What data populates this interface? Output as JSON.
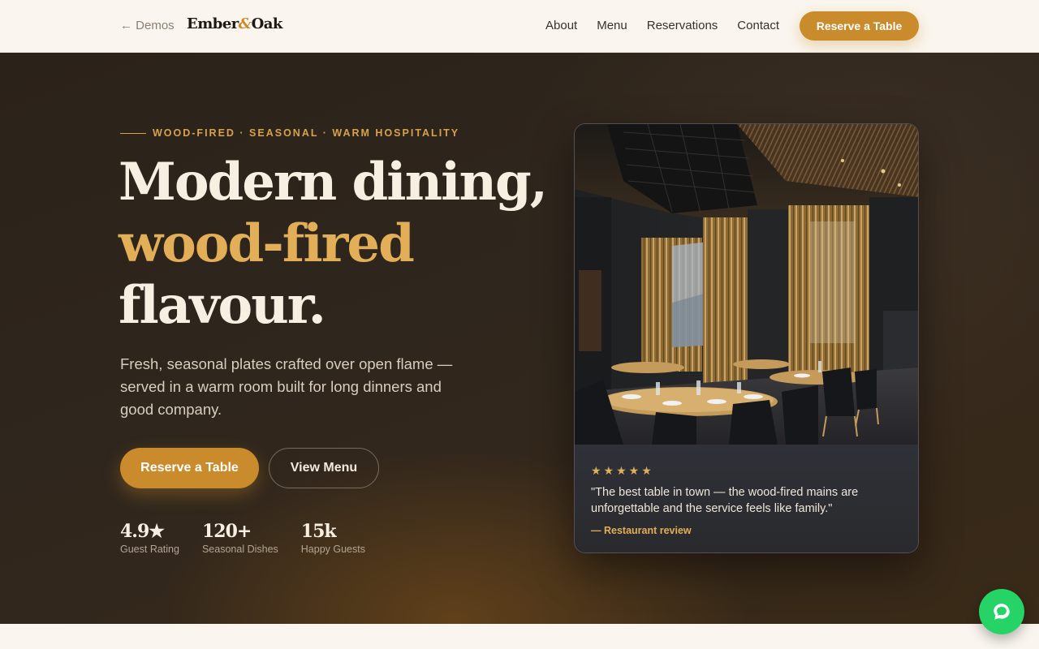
{
  "nav": {
    "back_label": "← Demos",
    "brand_left": "Ember",
    "brand_amp": "&",
    "brand_right": "Oak",
    "links": [
      "About",
      "Menu",
      "Reservations",
      "Contact"
    ],
    "cta_label": "Reserve a Table"
  },
  "hero": {
    "eyebrow": "WOOD-FIRED · SEASONAL · WARM HOSPITALITY",
    "headline_line1": "Modern dining,",
    "headline_accent": "wood-fired",
    "headline_line3": "flavour.",
    "lede": "Fresh, seasonal plates crafted over open flame — served in a warm room built for long dinners and good company.",
    "primary_button": "Reserve a Table",
    "secondary_button": "View Menu",
    "stats": [
      {
        "value": "4.9★",
        "label": "Guest Rating"
      },
      {
        "value": "120+",
        "label": "Seasonal Dishes"
      },
      {
        "value": "15k",
        "label": "Happy Guests"
      }
    ]
  },
  "review_card": {
    "stars": "★★★★★",
    "quote": "\"The best table in town — the wood-fired mains are unforgettable and the service feels like family.\"",
    "cite": "— Restaurant review"
  },
  "colors": {
    "accent": "#c98b2b",
    "accent_light": "#e2ae58",
    "hero_bg": "#2b2219",
    "cream": "#faf6ef",
    "chat_green": "#25d366"
  },
  "icons": {
    "chat": "chat-bubble-icon",
    "star": "star-icon",
    "back": "arrow-left-icon"
  }
}
